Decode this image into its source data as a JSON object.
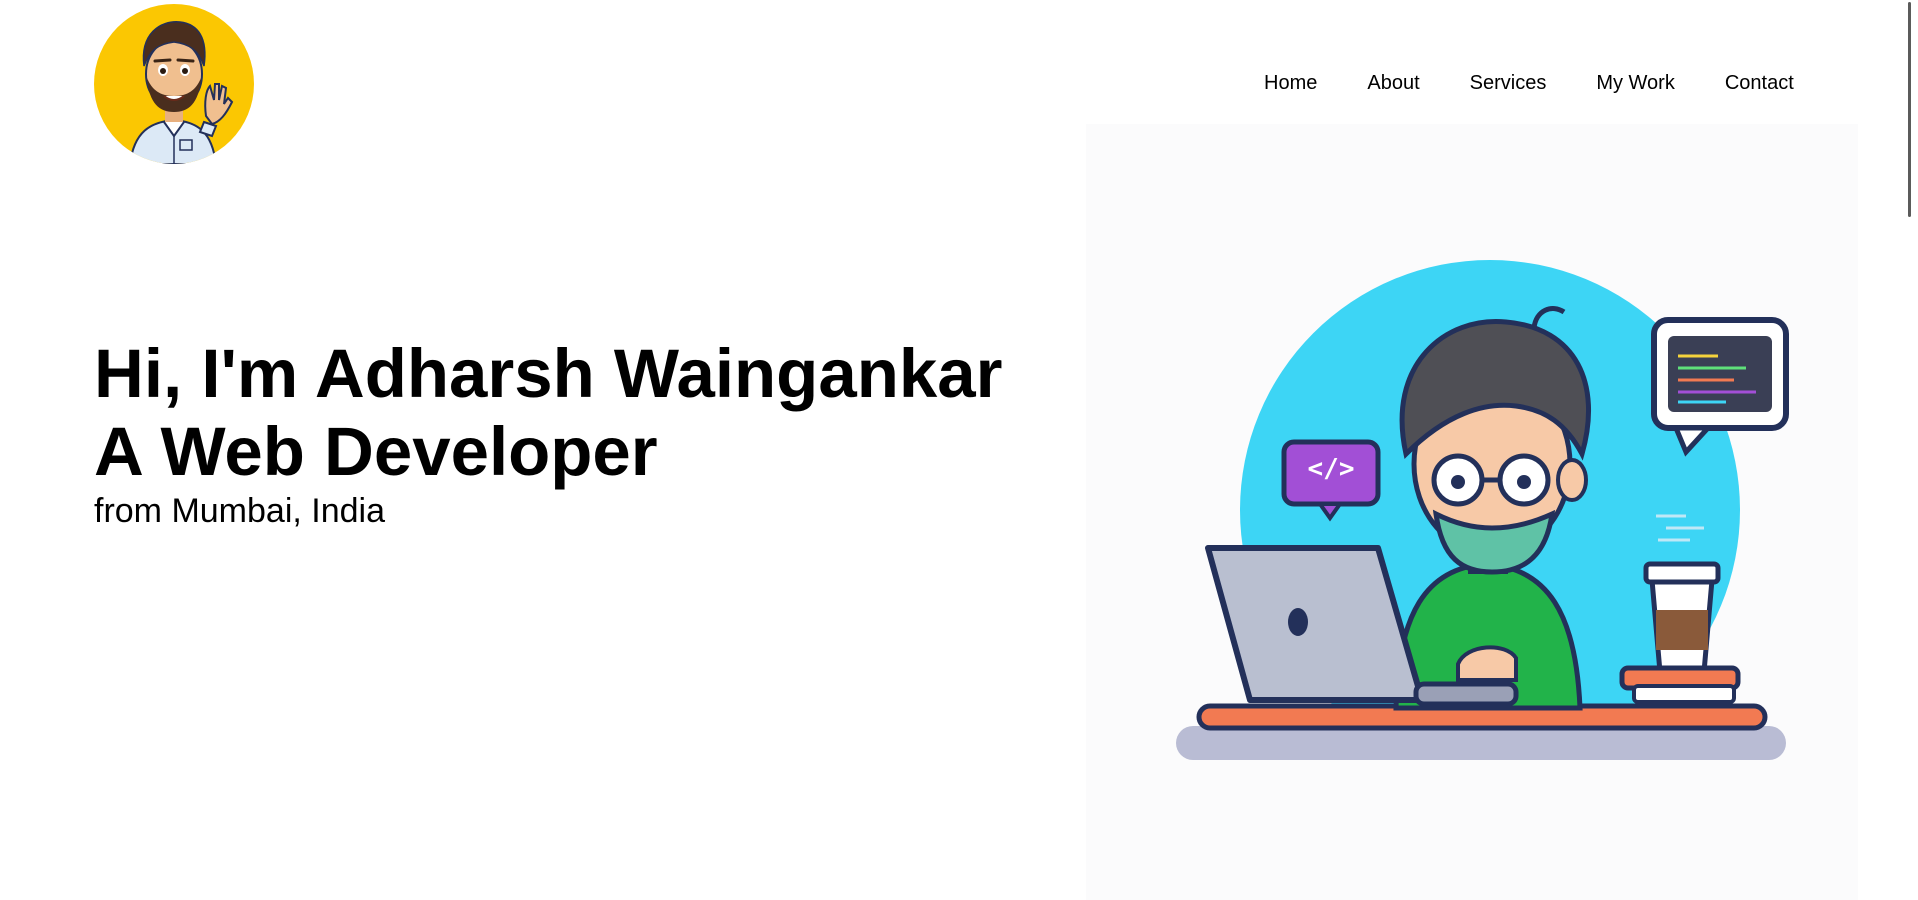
{
  "header": {
    "logo_alt": "Avatar",
    "nav": [
      {
        "label": "Home"
      },
      {
        "label": "About"
      },
      {
        "label": "Services"
      },
      {
        "label": "My Work"
      },
      {
        "label": "Contact"
      }
    ]
  },
  "hero": {
    "line1": "Hi, I'm Adharsh Waingankar",
    "line2": "A Web Developer",
    "location": "from Mumbai, India"
  },
  "illustration": {
    "code_bubble_text": "</>"
  },
  "colors": {
    "logo_bg": "#fbc702",
    "circle": "#3dd5f5",
    "shirt": "#22b34a",
    "mask": "#5fc2a6",
    "code_bubble": "#a24fd6"
  }
}
